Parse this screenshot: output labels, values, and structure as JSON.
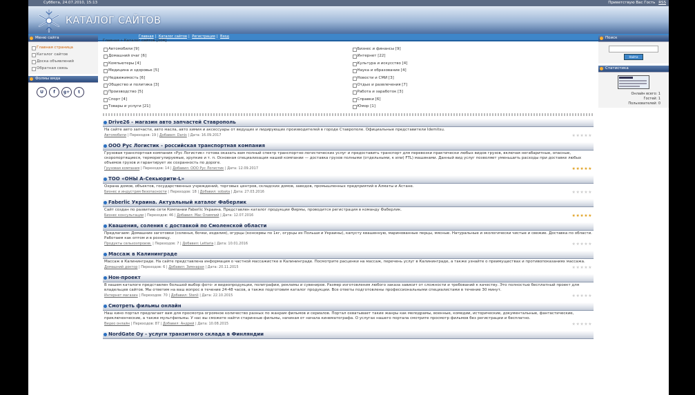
{
  "topbar": {
    "date": "Суббота, 24.07.2010, 15:13",
    "greeting": "Приветствую Вас Гость",
    "rss": "RSS"
  },
  "header": {
    "site_title": "КАТАЛОГ САЙТОВ",
    "nav": [
      "Главная",
      "Каталог сайтов",
      "Регистрация",
      "Вход"
    ]
  },
  "left": {
    "menu_title": "Меню сайта",
    "menu": [
      {
        "label": "Главная страница",
        "active": true
      },
      {
        "label": "Каталог сайтов",
        "active": false
      },
      {
        "label": "Доска объявлений",
        "active": false
      },
      {
        "label": "Обратная связь",
        "active": false
      }
    ],
    "social_title": "Фолмы вмда",
    "socials": [
      {
        "icon": "u-icon",
        "glyph": "U"
      },
      {
        "icon": "facebook-icon",
        "glyph": "f"
      },
      {
        "icon": "google-plus-icon",
        "glyph": "g+"
      },
      {
        "icon": "twitter-icon",
        "glyph": "t"
      }
    ]
  },
  "right": {
    "search_title": "Поиск",
    "search_button": "Найти",
    "stats_title": "Статистика",
    "stats": [
      "Онлайн всего: 1",
      "Гостей: 1",
      "Пользователей: 0"
    ]
  },
  "breadcrumb": "Главная » Каталог сайтов [104]",
  "categories": [
    {
      "label": "Автомобили [9]"
    },
    {
      "label": "Бизнес и финансы [9]"
    },
    {
      "label": "Домашний очаг [6]"
    },
    {
      "label": "Интернет [22]"
    },
    {
      "label": "Компьютеры [4]"
    },
    {
      "label": "Культура и искусство [4]"
    },
    {
      "label": "Медицина и здоровье [5]"
    },
    {
      "label": "Наука и образование [4]"
    },
    {
      "label": "Недвижимость [6]"
    },
    {
      "label": "Новости и СМИ [3]"
    },
    {
      "label": "Общество и политика [3]"
    },
    {
      "label": "Отдых и развлечения [7]"
    },
    {
      "label": "Производство [5]"
    },
    {
      "label": "Работа и заработок [3]"
    },
    {
      "label": "Спорт [4]"
    },
    {
      "label": "Справки [6]"
    },
    {
      "label": "Товары и услуги [21]"
    },
    {
      "label": "Юмор [1]"
    }
  ],
  "entries": [
    {
      "title": "Drive26 - магазин авто запчастей Ставрополь",
      "desc": "На сайте авто запчасти, авто масла, авто химия и аксессуары от ведущих и лидирующих производителей в городе Ставрополе. Официальные представители Idemitsu.",
      "category": "Автомобили",
      "views": "Переходов: 19",
      "added": "Добавил: Danis",
      "date": "Дата: 16.09.2017",
      "rating": 0
    },
    {
      "title": "ООО Рус Логистик - российская транспортная компания",
      "desc": "Грузовая транспортная компания «Рус Логистик» готова оказать вам полный спектр транспортно-логистических услуг и предоставить транспорт для перевозки практически любых видов грузов, включая негабаритные, опасные, скоропортящиеся, терморегулируемые, хрупкие и т. п. Основная специализация нашей компании — доставка грузов полными (отдельными, к или) FTL) машинами. Данный вид услуг позволяет уменьшить расходы при доставке любых объемов грузов и гарантирует их сохранность по дороге.",
      "category": "Грузовая компания",
      "views": "Переходов: 14",
      "added": "Добавил: ООО Рус Логистик",
      "date": "Дата: 12.09.2017",
      "rating": 5
    },
    {
      "title": "ТОО «ОНЫ А-Секьюрити-L»",
      "desc": "Охрана домов, объектов, государственных учреждений, торговых центров, складских домов, заводов, промышленных предприятий в Алматы и Астане.",
      "category": "Бизнес и индустрия безопасности",
      "views": "Переходов: 18",
      "added": "Добавил: sobaka",
      "date": "Дата: 27.03.2016",
      "rating": 0
    },
    {
      "title": "Faberlic Украина. Актуальный каталог Фаберлик",
      "desc": "Сайт создан по развитию сети Компании Faberlic Украина. Представлен каталог продукции Фирмы, проводится регистрация в команду Фаберлик.",
      "category": "Бизнес консультации",
      "views": "Переходов: 46",
      "added": "Добавил: Мас Олимпий",
      "date": "Дата: 12.07.2016",
      "rating": 5
    },
    {
      "title": "Квашения, соления с доставкой по Смоленской области",
      "desc": "Предлагаем: Домашние заготовки (соленья, бочки, изделия), огурцы (консервы по 1кг, огурцы из Польши и Украины), капусту квашенную, маринованные перцы, мясные. Натуральные и экологически чистые и свежие. Доставка по области. Работаем как оптом и в розницу.",
      "category": "Продукты сельхозпроизв.",
      "views": "Переходов: 7",
      "added": "Добавил: Lettaria",
      "date": "Дата: 10.01.2016",
      "rating": 0
    },
    {
      "title": "Массаж в Калининграде",
      "desc": "Массаж в Калининграде. На сайте представлена информация о частной массажистке в Калининграде. Посмотрите расценки на массаж, перечень услуг в Калининграде, а также узнайте о преимуществах и противопоказаниях массажа.",
      "category": "Домашний доктор",
      "views": "Переходов: 6",
      "added": "Добавил: Зимнарая",
      "date": "Дата: 20.11.2015",
      "rating": 0
    },
    {
      "title": "Нон-проект",
      "desc": "В нашем каталоге представлен большой выбор фото- и видеопродукции, полиграфии, рекламы и сувениров. Размер изготовления любого заказа зависит от сложности и требований к качеству. Это полностью бесплатный проект для владельцев сайтов. Мы ответим на ваш вопрос в течение 24-48 часов, а также подготовим каталог продукции. Все ответы подготовлены профессиональными специалистами в течение 30 минут.",
      "category": "Интернет магазин",
      "views": "Переходов: 70",
      "added": "Добавил: Stenli",
      "date": "Дата: 22.10.2015",
      "rating": 0
    },
    {
      "title": "Смотреть фильмы онлайн",
      "desc": "Наш кино портал предлагает вам для просмотра огромное количество разных по жанрам фильмов и сериалов. Портал охватывает такие жанры как мелодрамы, военные, комедии, исторические, документальные, фантастические, приключенческие, а также мультфильмы. У нас вы сможете найти старинные фильмы, начиная от начала кинематографа. О услугах нашего портала смотрите просмотр фильмов без регистрации и бесплатно.",
      "category": "Видео онлайн",
      "views": "Переходов: 87",
      "added": "Добавил: Андрей",
      "date": "Дата: 10.08.2015",
      "rating": 0
    },
    {
      "title": "NordGate Oy - услуги транзитного склада в Финляндии",
      "desc": "",
      "category": "",
      "views": "",
      "added": "",
      "date": "",
      "rating": 0
    }
  ]
}
